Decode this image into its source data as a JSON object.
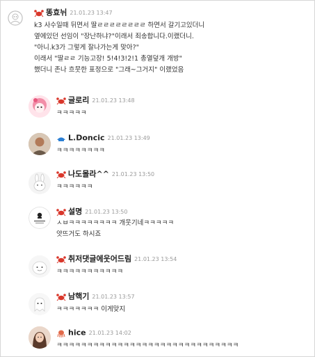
{
  "comments": [
    {
      "nickname": "똥효뉘",
      "date": "21.01.23 13:47",
      "avatar_icon": "default-avatar-icon",
      "lines": [
        "k3 사수일때 뒤면서 딸ㄹㄹㄹㄹㄹㄹㄹㄹ 하면서 갈기고있더니",
        "옆에있던 선임이 \"장난하냐?\"이래서 죄송합니다.이랬더니.",
        "\"아니.k3가 그렇게 잘나가는게 맞아?\"",
        "이래서 \"딸ㄹㄹ 기능고장! 5!4!3!2!1 총열덮개 개방\"",
        "했더니 존나 흐뭇한 표정으로 \"그래~그거지\" 이랬었음"
      ]
    },
    {
      "nickname": "글로리",
      "date": "21.01.23 13:48",
      "avatar_icon": "pink-character-avatar-icon",
      "lines": [
        "ㅋㅋㅋㅋㅋ"
      ]
    },
    {
      "nickname": "L.Doncic",
      "date": "21.01.23 13:49",
      "avatar_icon": "photo-avatar-icon",
      "level_icon": "blue-level-icon",
      "lines": [
        "ㅋㅋㅋㅋㅋㅋㅋㅋ"
      ]
    },
    {
      "nickname": "나도몰라^^",
      "date": "21.01.23 13:50",
      "avatar_icon": "rabbit-avatar-icon",
      "lines": [
        "ㅋㅋㅋㅋㅋㅋ"
      ]
    },
    {
      "nickname": "설명",
      "date": "21.01.23 13:50",
      "avatar_icon": "logo-avatar-icon",
      "lines": [
        "ㅅㅂㅋㅋㅋㅋㅋㅋㅋㅋ 개웃기네ㅋㅋㅋㅋㅋ",
        "얏뜨거도 하시죠"
      ]
    },
    {
      "nickname": "취저댓글에웃어드림",
      "date": "21.01.23 13:54",
      "avatar_icon": "blob-avatar-icon",
      "lines": [
        "ㅋㅋㅋㅋㅋㅋㅋㅋㅋㅋㅋ"
      ]
    },
    {
      "nickname": "남핵기",
      "date": "21.01.23 13:57",
      "avatar_icon": "ghost-avatar-icon",
      "lines": [
        "ㅋㅋㅋㅋㅋㅋㅋ 이게맞지"
      ]
    },
    {
      "nickname": "hice",
      "date": "21.01.23 14:02",
      "avatar_icon": "photo-avatar-icon",
      "level_icon": "octopus-level-icon",
      "lines": [
        "ㅋㅋㅋㅋㅋㅋㅋㅋㅋㅋㅋㅋㅋㅋㅋㅋㅋㅋㅋㅋㅋㅋㅋㅋㅋㅋㅋㅋㅋㅋ"
      ]
    }
  ],
  "colors": {
    "crab": "#d9372b",
    "octopus": "#e26a4a",
    "blue_level": "#2b7fd4",
    "date": "#9a9a9a",
    "border": "#d6d6d6"
  }
}
